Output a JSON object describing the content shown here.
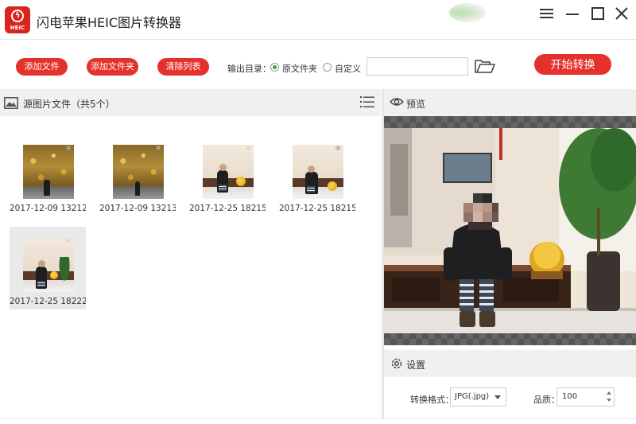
{
  "window": {
    "title": "闪电苹果HEIC图片转换器",
    "logo_text": "HEIC"
  },
  "toolbar": {
    "add_file": "添加文件",
    "add_folder": "添加文件夹",
    "clear_list": "清除列表",
    "output_dir_label": "输出目录：",
    "radio_original": "原文件夹",
    "radio_custom": "自定义",
    "selected_output": "原文件夹",
    "path_value": "",
    "start": "开始转换"
  },
  "source_panel": {
    "title": "源图片文件（共5个）",
    "files": [
      {
        "name": "2017-12-09 13212...",
        "scene": "tree",
        "selected": false
      },
      {
        "name": "2017-12-09 13213...",
        "scene": "tree",
        "selected": false
      },
      {
        "name": "2017-12-25 18215...",
        "scene": "room",
        "selected": false
      },
      {
        "name": "2017-12-25 18215...",
        "scene": "room",
        "selected": false
      },
      {
        "name": "2017-12-25 18222...",
        "scene": "room",
        "selected": true
      }
    ]
  },
  "preview": {
    "title": "预览"
  },
  "settings": {
    "title": "设置",
    "format_label": "转换格式：",
    "format_value": "JPG(.jpg)",
    "quality_label": "品质：",
    "quality_value": "100"
  },
  "colors": {
    "accent_red": "#e4312b",
    "radio_green": "#2fa34a",
    "panel_header": "#f0f0f0"
  },
  "icons": {
    "menu": "hamburger-icon",
    "minimize": "minimize-icon",
    "maximize": "maximize-icon",
    "close": "close-icon",
    "folder": "folder-open-icon",
    "image": "image-icon",
    "list": "list-view-icon",
    "eye": "eye-icon",
    "gear": "gear-icon"
  }
}
